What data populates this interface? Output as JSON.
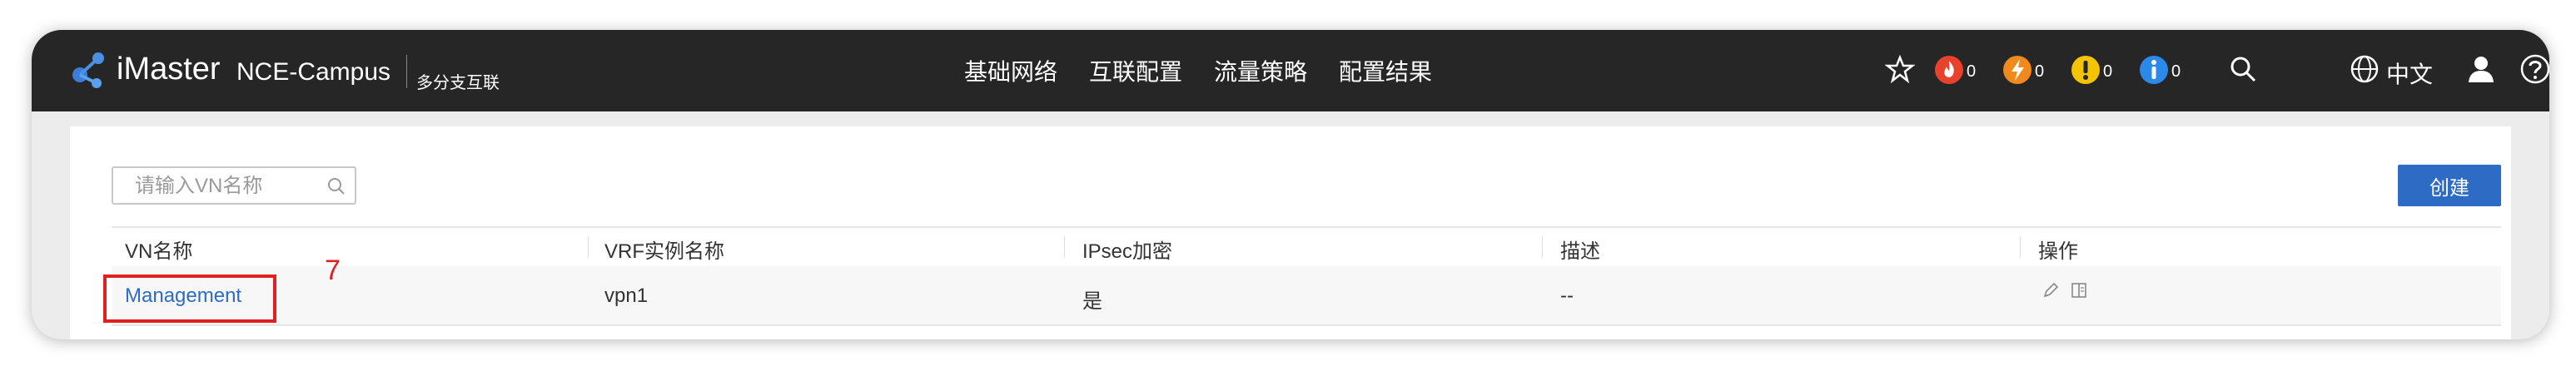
{
  "header": {
    "brand": "iMaster",
    "product": "NCE-Campus",
    "scenario": "多分支互联",
    "nav": [
      "基础网络",
      "互联配置",
      "流量策略",
      "配置结果"
    ],
    "alarms": [
      {
        "icon": "critical-alarm-icon",
        "color": "#e8412c",
        "count": "0"
      },
      {
        "icon": "major-alarm-icon",
        "color": "#f08a1c",
        "count": "0"
      },
      {
        "icon": "minor-alarm-icon",
        "color": "#f5c400",
        "count": "0"
      },
      {
        "icon": "info-alarm-icon",
        "color": "#2b89e8",
        "count": "0"
      }
    ],
    "language": "中文"
  },
  "search": {
    "placeholder": "请输入VN名称"
  },
  "actions": {
    "create_label": "创建"
  },
  "table": {
    "columns": [
      "VN名称",
      "VRF实例名称",
      "IPsec加密",
      "描述",
      "操作"
    ],
    "rows": [
      {
        "vn_name": "Management",
        "vrf": "vpn1",
        "ipsec": "是",
        "description": "--"
      }
    ]
  },
  "annotation": {
    "step": "7",
    "color": "#e02020"
  },
  "colors": {
    "topbar": "#262626",
    "accent": "#2d6bc4"
  }
}
